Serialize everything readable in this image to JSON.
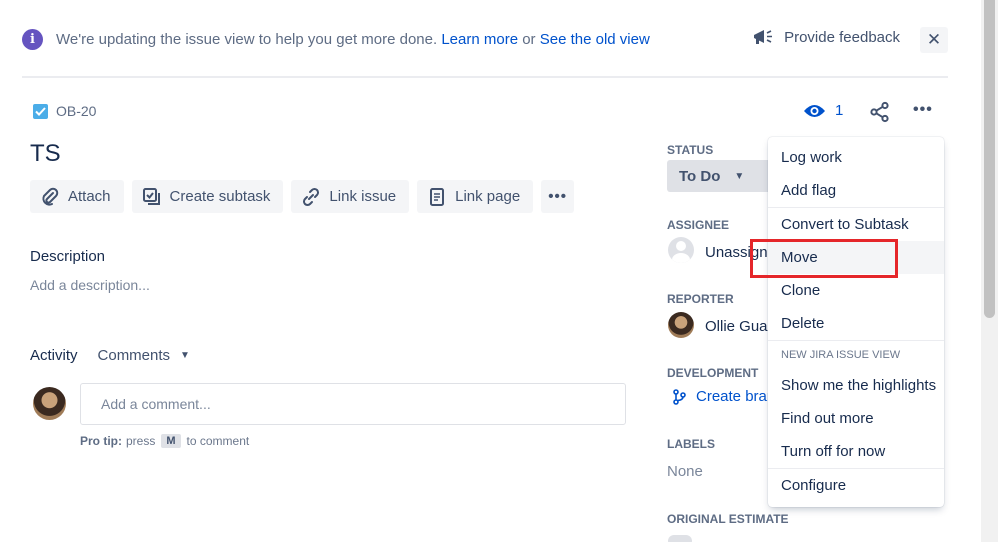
{
  "banner": {
    "text": "We're updating the issue view to help you get more done.",
    "learn_more": "Learn more",
    "or": "or",
    "old_view": "See the old view",
    "feedback": "Provide feedback"
  },
  "issue": {
    "key": "OB-20",
    "title": "TS"
  },
  "actions": {
    "attach": "Attach",
    "create_subtask": "Create subtask",
    "link_issue": "Link issue",
    "link_page": "Link page"
  },
  "description": {
    "label": "Description",
    "placeholder": "Add a description..."
  },
  "activity": {
    "label": "Activity",
    "filter": "Comments",
    "comment_placeholder": "Add a comment...",
    "pro_tip": "Pro tip:",
    "press": "press",
    "key": "M",
    "to_comment": "to comment"
  },
  "watchers": {
    "count": "1"
  },
  "fields": {
    "status_label": "STATUS",
    "status_value": "To Do",
    "assignee_label": "ASSIGNEE",
    "assignee_value": "Unassigne",
    "reporter_label": "REPORTER",
    "reporter_value": "Ollie Guan",
    "development_label": "DEVELOPMENT",
    "development_value": "Create bran",
    "labels_label": "LABELS",
    "labels_value": "None",
    "original_estimate_label": "ORIGINAL ESTIMATE"
  },
  "menu": {
    "log_work": "Log work",
    "add_flag": "Add flag",
    "convert": "Convert to Subtask",
    "move": "Move",
    "clone": "Clone",
    "delete": "Delete",
    "heading": "NEW JIRA ISSUE VIEW",
    "highlights": "Show me the highlights",
    "find_out_more": "Find out more",
    "turn_off": "Turn off for now",
    "configure": "Configure"
  },
  "colors": {
    "accent": "#0052cc",
    "highlight": "#e5262a",
    "info": "#6554c0"
  }
}
